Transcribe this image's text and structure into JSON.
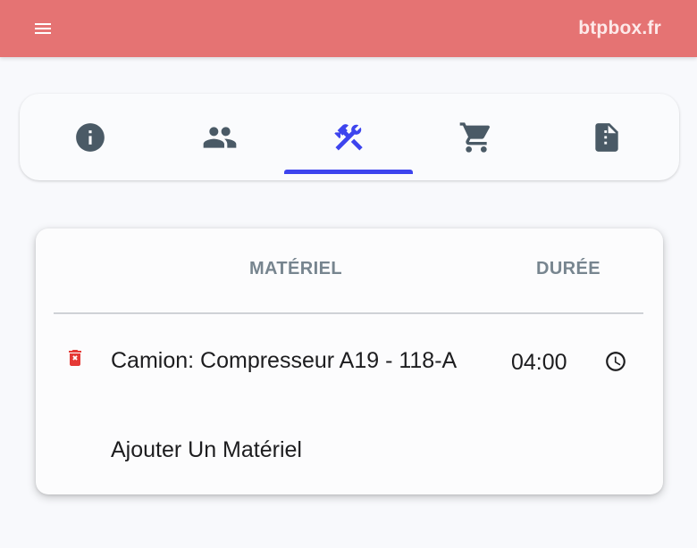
{
  "header": {
    "brand": "btpbox.fr",
    "menu_icon": "menu-icon",
    "background_color": "#e57373"
  },
  "tabs": [
    {
      "icon": "info-icon",
      "active": false
    },
    {
      "icon": "people-icon",
      "active": false
    },
    {
      "icon": "tools-icon",
      "active": true
    },
    {
      "icon": "cart-icon",
      "active": false
    },
    {
      "icon": "note-icon",
      "active": false
    }
  ],
  "accent_color": "#3d44ee",
  "table": {
    "headers": {
      "material": "MATÉRIEL",
      "duration": "DURÉE"
    },
    "rows": [
      {
        "material": "Camion: Compresseur A19 - 118-A",
        "duration": "04:00",
        "delete_icon": "delete-icon",
        "clock_icon": "clock-icon"
      }
    ],
    "add_label": "Ajouter Un Matériel"
  }
}
